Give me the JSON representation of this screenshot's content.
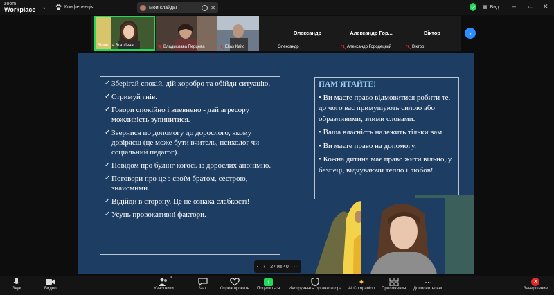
{
  "app": {
    "logo_top": "zoom",
    "logo_bottom": "Workplace",
    "meeting_menu": "Конференція"
  },
  "share_pill": {
    "title": "Мои слайды"
  },
  "header_right": {
    "view_label": "Вид"
  },
  "participants_strip": [
    {
      "name": "Віолетта Вталіївна",
      "muted": false
    },
    {
      "name": "Владислава Пєрцева",
      "muted": true
    },
    {
      "name": "Elias Kaito",
      "muted": true
    },
    {
      "tile_name": "Олександр",
      "name": "Олександр",
      "muted": false
    },
    {
      "tile_name": "Александр Гор...",
      "name": "Александр Городецкий",
      "muted": true
    },
    {
      "tile_name": "Віктор",
      "name": "Віктор",
      "muted": true
    }
  ],
  "slide": {
    "left_items": [
      "Зберігай спокій, дій хоробро та обійди ситуацію.",
      "Стримуй гнів.",
      "Говори спокійно і впевнено - дай агресору можливість зупинитися.",
      "Звернися по допомогу до дорослого, якому довіряєш (це може бути вчитель, психолог чи соціальний педагог).",
      "Повідом про булінг когось із дорослих анонімно.",
      "Поговори про це з своїм братом, сестрою, знайомими.",
      "Відійди в сторону. Це не ознака слабкості!",
      "Усунь провокативні фактори."
    ],
    "right_title": "ПАМ'ЯТАЙТЕ!",
    "right_items": [
      "• Ви маєте право відмовитися робити те, до чого вас примушують силою або образливими, злими словами.",
      "• Ваша власність належить тільки вам.",
      "• Ви маєте право на допомогу.",
      "• Кожна дитина має право жити вільно, у безпеці, відчуваючи тепло і любов!"
    ],
    "pager": {
      "text": "27 из 40"
    }
  },
  "toolbar": {
    "audio": "Звук",
    "video": "Видео",
    "participants": "Участники",
    "participants_count": "9",
    "chat": "Чат",
    "react": "Отреагировать",
    "share": "Поделиться",
    "host_tools": "Инструменты организатора",
    "ai": "AI Companion",
    "apps": "Приложения",
    "more": "Дополнительно",
    "end": "Завершение"
  },
  "colors": {
    "slide_bg": "#1e3d63",
    "accent_blue": "#2d8cff",
    "share_green": "#23d959",
    "end_red": "#e02828",
    "title_blue": "#9dcfee"
  }
}
